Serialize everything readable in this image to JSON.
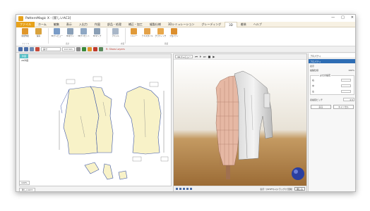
{
  "window": {
    "title": "PatternMagic X - [新しいAC3]",
    "controls": [
      "—",
      "□",
      "✕"
    ]
  },
  "menu": {
    "items": [
      "ファイル",
      "ホーム",
      "編集",
      "表示",
      "入出力",
      "作図",
      "部品・処理",
      "補正・加工",
      "縫製仕様",
      "3Dシミュレーション",
      "グレーディング",
      "3D",
      "着装",
      "ヘルプ"
    ]
  },
  "ribbon": {
    "buttons": [
      {
        "label": "新規作成",
        "color": "#e0962a"
      },
      {
        "label": "保存",
        "color": "#d9a23d"
      },
      {
        "label": "3Dプレビュー",
        "color": "#7a9cc7"
      },
      {
        "label": "3Dボディ",
        "color": "#8aa0b8"
      },
      {
        "label": "3Dプリセット",
        "color": "#8fa8c4"
      },
      {
        "label": "3Dマップ",
        "color": "#8b9fb5"
      },
      {
        "label": "アパレル",
        "color": "#a9b7c8"
      },
      {
        "label": "トルソー",
        "color": "#e09a3a"
      },
      {
        "label": "テキスタイル",
        "color": "#e3a24a"
      },
      {
        "label": "グラフィック",
        "color": "#e8a84c"
      },
      {
        "label": "プロパティ",
        "color": "#dc8f2e"
      }
    ],
    "group_labels": [
      "ファイル",
      "表示",
      "衣装",
      "着装"
    ]
  },
  "toolbar": {
    "select_value": "実寸",
    "zoom_value": "0.0 mm",
    "layer_label": "R: Show Layers"
  },
  "pattern_pane": {
    "tab": "作図",
    "sublabel": "2D作図",
    "zoom": "100%",
    "sheet_tab": "新しいAC3"
  },
  "view3d": {
    "label": "3Dプレビュー",
    "controls": [
      "⏮",
      "⏵",
      "⏭",
      "■",
      "▶"
    ],
    "hint": "表示・[SHIFT]+[ドラッグ]で回転",
    "ok_button": "閉じる"
  },
  "props": {
    "title": "プロパティ",
    "selected": "プロパティ",
    "rows": [
      {
        "k": "表示",
        "v": ""
      },
      {
        "k": "縫製仕様",
        "v": "100%"
      }
    ],
    "group_title": "よせの設定",
    "lines": [
      "右",
      "中",
      "左"
    ],
    "len_label": "表縫目ピッチ",
    "len_value": "2.5",
    "buttons": [
      "戻る",
      "キャンセル"
    ]
  }
}
